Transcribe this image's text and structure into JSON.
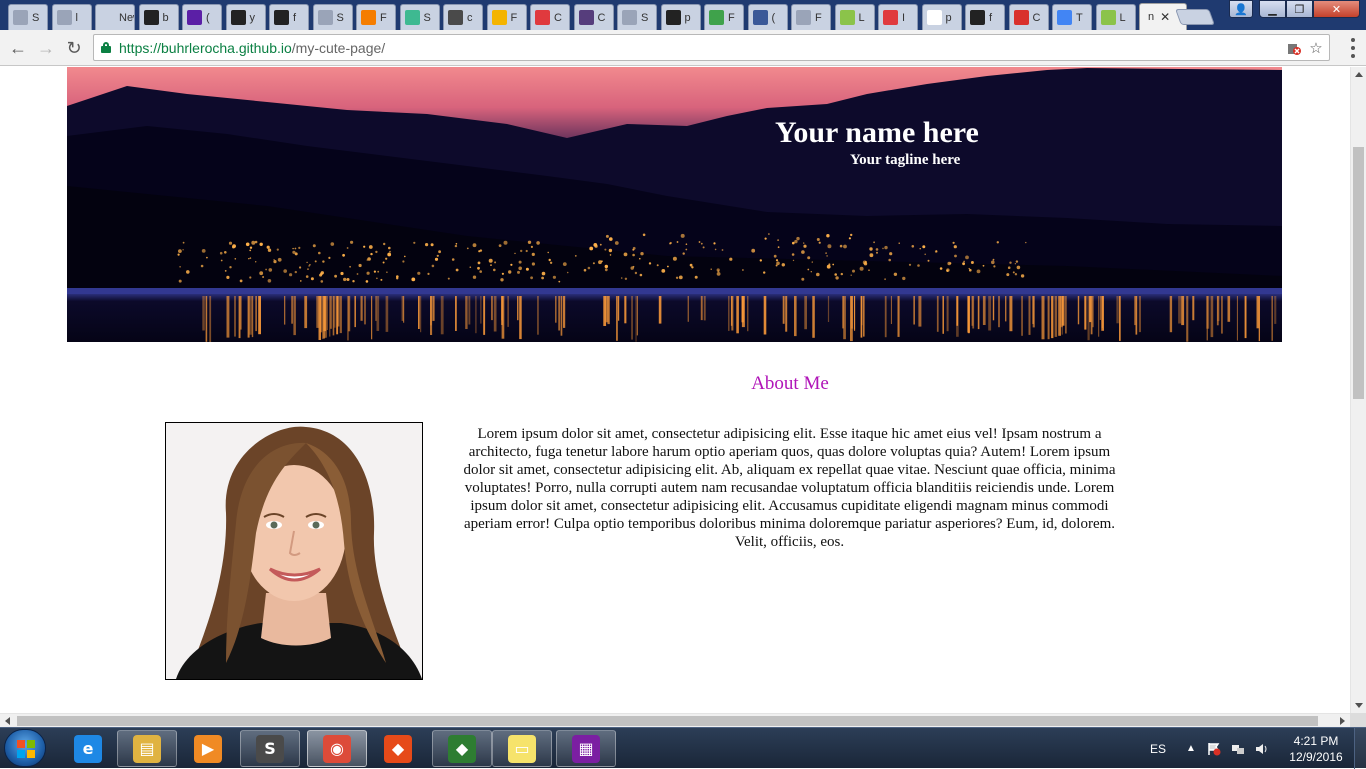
{
  "browser": {
    "tabs": [
      {
        "favicon": "page-icon",
        "label": "S",
        "color": "#9aa4b8"
      },
      {
        "favicon": "page-icon",
        "label": "l",
        "color": "#9aa4b8"
      },
      {
        "favicon": "none",
        "label": "New",
        "color": "#c9d2e2"
      },
      {
        "favicon": "github-icon",
        "label": "b",
        "color": "#222222"
      },
      {
        "favicon": "yahoo-mail-icon",
        "label": "(",
        "color": "#5b1fa6"
      },
      {
        "favicon": "github-icon",
        "label": "y",
        "color": "#222222"
      },
      {
        "favicon": "flag-icon",
        "label": "f",
        "color": "#222222"
      },
      {
        "favicon": "page-icon",
        "label": "S",
        "color": "#9aa4b8"
      },
      {
        "favicon": "blogger-icon",
        "label": "F",
        "color": "#f57d00"
      },
      {
        "favicon": "slack-icon",
        "label": "S",
        "color": "#3eb991"
      },
      {
        "favicon": "hashtag-icon",
        "label": "c",
        "color": "#4a4a4a"
      },
      {
        "favicon": "slides-icon",
        "label": "F",
        "color": "#f4b400"
      },
      {
        "favicon": "m-icon",
        "label": "C",
        "color": "#e03a3e"
      },
      {
        "favicon": "bootstrap-icon",
        "label": "C",
        "color": "#563d7c"
      },
      {
        "favicon": "page-icon",
        "label": "S",
        "color": "#9aa4b8"
      },
      {
        "favicon": "github-icon",
        "label": "p",
        "color": "#222222"
      },
      {
        "favicon": "px-icon",
        "label": "F",
        "color": "#3fa24b"
      },
      {
        "favicon": "facebook-icon",
        "label": "(",
        "color": "#3b5998"
      },
      {
        "favicon": "page-icon",
        "label": "F",
        "color": "#9aa4b8"
      },
      {
        "favicon": "e-icon",
        "label": "L",
        "color": "#8bc34a"
      },
      {
        "favicon": "m-icon",
        "label": "I",
        "color": "#e03a3e"
      },
      {
        "favicon": "google-icon",
        "label": "p",
        "color": "#ffffff"
      },
      {
        "favicon": "flag-icon",
        "label": "f",
        "color": "#222222"
      },
      {
        "favicon": "red-f-icon",
        "label": "C",
        "color": "#d9302c"
      },
      {
        "favicon": "translate-icon",
        "label": "T",
        "color": "#4285f4"
      },
      {
        "favicon": "e-icon",
        "label": "L",
        "color": "#8bc34a"
      }
    ],
    "active_tab": {
      "label": "n",
      "close": "✕"
    },
    "url": {
      "host": "https://buhrlerocha.github.io",
      "path": "/my-cute-page/"
    },
    "nav": {
      "back": "←",
      "forward": "→",
      "reload": "↻"
    },
    "star": "☆"
  },
  "page": {
    "hero": {
      "title": "Your name here",
      "tagline": "Your tagline here"
    },
    "about": {
      "heading": "About Me",
      "body": "Lorem ipsum dolor sit amet, consectetur adipisicing elit. Esse itaque hic amet eius vel! Ipsam nostrum a architecto, fuga tenetur labore harum optio aperiam quos, quas dolore voluptas quia? Autem! Lorem ipsum dolor sit amet, consectetur adipisicing elit. Ab, aliquam ex repellat quae vitae. Nesciunt quae officia, minima voluptates! Porro, nulla corrupti autem nam recusandae voluptatum officia blanditiis reiciendis unde. Lorem ipsum dolor sit amet, consectetur adipisicing elit. Accusamus cupiditate eligendi magnam minus commodi aperiam error! Culpa optio temporibus doloribus minima doloremque pariatur asperiores? Eum, id, dolorem. Velit, officiis, eos."
    },
    "colors": {
      "heading": "#b014b8"
    }
  },
  "taskbar": {
    "items": [
      {
        "name": "internet-explorer-icon",
        "glyph": "e",
        "color": "#1e88e5",
        "state": "pinned"
      },
      {
        "name": "file-explorer-icon",
        "glyph": "▤",
        "color": "#e0b341",
        "state": "open"
      },
      {
        "name": "media-player-icon",
        "glyph": "▶",
        "color": "#f08a24",
        "state": "pinned"
      },
      {
        "name": "sublime-text-icon",
        "glyph": "S",
        "color": "#4a4a4a",
        "state": "open"
      },
      {
        "name": "chrome-icon",
        "glyph": "◉",
        "color": "#dd4b39",
        "state": "active"
      },
      {
        "name": "git-icon",
        "glyph": "◆",
        "color": "#e64a19",
        "state": "pinned"
      },
      {
        "name": "git-gui-icon",
        "glyph": "◆",
        "color": "#2e7d32",
        "state": "open"
      },
      {
        "name": "sticky-notes-icon",
        "glyph": "▭",
        "color": "#f6e36b",
        "state": "open"
      },
      {
        "name": "winrar-icon",
        "glyph": "▦",
        "color": "#7b1fa2",
        "state": "open"
      }
    ],
    "tray": {
      "language": "ES",
      "chevron": "▲"
    },
    "clock": {
      "time": "4:21 PM",
      "date": "12/9/2016"
    }
  }
}
